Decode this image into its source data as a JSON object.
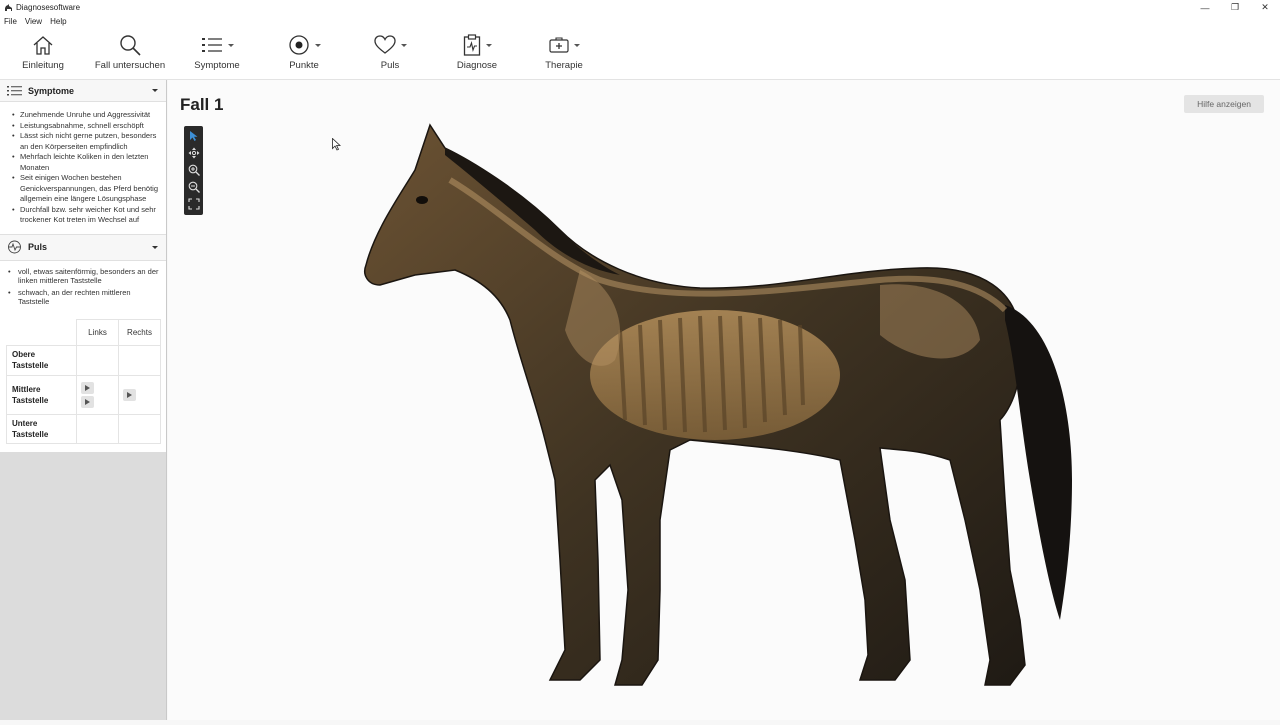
{
  "window": {
    "title": "Diagnosesoftware",
    "controls": {
      "minimize": "—",
      "maximize": "❐",
      "close": "✕"
    }
  },
  "menu": [
    "File",
    "View",
    "Help"
  ],
  "toolbar": {
    "items": [
      {
        "label": "Einleitung",
        "icon": "home-icon"
      },
      {
        "label": "Fall untersuchen",
        "icon": "search-icon"
      },
      {
        "label": "Symptome",
        "icon": "list-icon"
      },
      {
        "label": "Punkte",
        "icon": "target-point-icon"
      },
      {
        "label": "Puls",
        "icon": "heart-icon"
      },
      {
        "label": "Diagnose",
        "icon": "clipboard-icon"
      },
      {
        "label": "Therapie",
        "icon": "first-aid-icon"
      }
    ]
  },
  "sidebar": {
    "symptome": {
      "title": "Symptome",
      "items": [
        "Zunehmende Unruhe und Aggressivität",
        "Leistungsabnahme, schnell erschöpft",
        "Lässt sich nicht gerne putzen, besonders an den Körperseiten empfindlich",
        "Mehrfach leichte Koliken in den letzten Monaten",
        "Seit einigen Wochen bestehen Genickverspannungen, das Pferd benötig allgemein eine längere Lösungsphase",
        "Durchfall bzw. sehr weicher Kot und sehr trockener Kot treten im Wechsel auf"
      ]
    },
    "puls": {
      "title": "Puls",
      "items": [
        "voll, etwas saitenförmig, besonders an der linken mittleren Taststelle",
        "schwach, an der rechten mittleren Taststelle"
      ],
      "table": {
        "columns": [
          "Links",
          "Rechts"
        ],
        "rows": [
          "Obere Taststelle",
          "Mittlere Taststelle",
          "Untere Taststelle"
        ]
      }
    }
  },
  "main": {
    "case_title": "Fall 1",
    "help_button": "Hilfe anzeigen",
    "viewer_tools": [
      "select-cursor-icon",
      "move-icon",
      "zoom-in-icon",
      "zoom-out-icon",
      "fit-screen-icon"
    ]
  },
  "colors": {
    "accent": "#2f7fc1",
    "toolbar_bg": "#ffffff",
    "sidebar_bg": "#dcdcdc"
  }
}
